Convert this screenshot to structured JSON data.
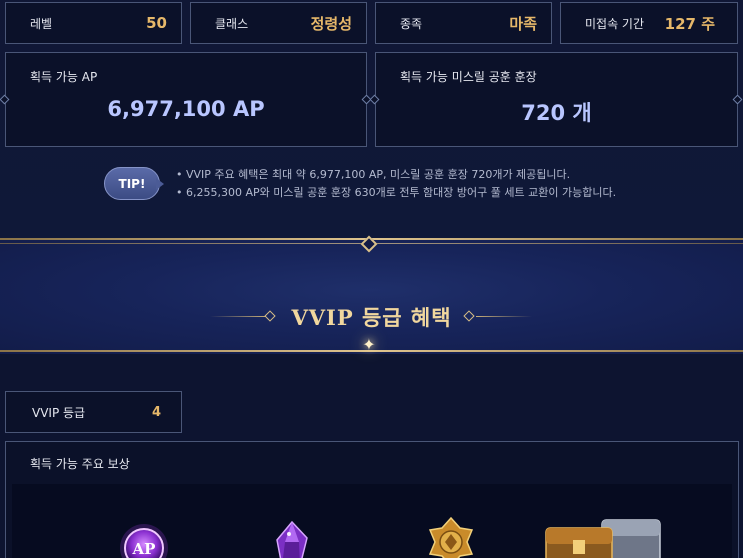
{
  "stats": [
    {
      "label": "레벨",
      "value": "50"
    },
    {
      "label": "클래스",
      "value": "정령성"
    },
    {
      "label": "종족",
      "value": "마족"
    },
    {
      "label": "미접속 기간",
      "value": "127 주"
    }
  ],
  "summary": [
    {
      "label": "획득 가능 AP",
      "value": "6,977,100 AP"
    },
    {
      "label": "획득 가능 미스릴 공훈 훈장",
      "value": "720 개"
    }
  ],
  "tip": {
    "badge": "TIP!",
    "lines": [
      "VVIP 주요 혜택은 최대 약 6,977,100 AP, 미스릴 공훈 훈장 720개가 제공됩니다.",
      "6,255,300 AP와 미스릴 공훈 훈장 630개로 전투 함대장 방어구 풀 세트 교환이 가능합니다."
    ]
  },
  "banner": {
    "title": "VVIP 등급 혜택"
  },
  "vvip": {
    "label": "VVIP 등급",
    "value": "4"
  },
  "rewards": {
    "title": "획득 가능 주요 보상",
    "items": [
      {
        "icon": "ap-orb-icon",
        "text": "AP"
      },
      {
        "icon": "purple-crystal-icon"
      },
      {
        "icon": "gold-medal-icon"
      },
      {
        "icon": "treasure-chest-icon"
      }
    ]
  },
  "colors": {
    "accent_gold": "#e6b86a",
    "value_blue": "#b9c6ff",
    "background": "#0d1430"
  }
}
